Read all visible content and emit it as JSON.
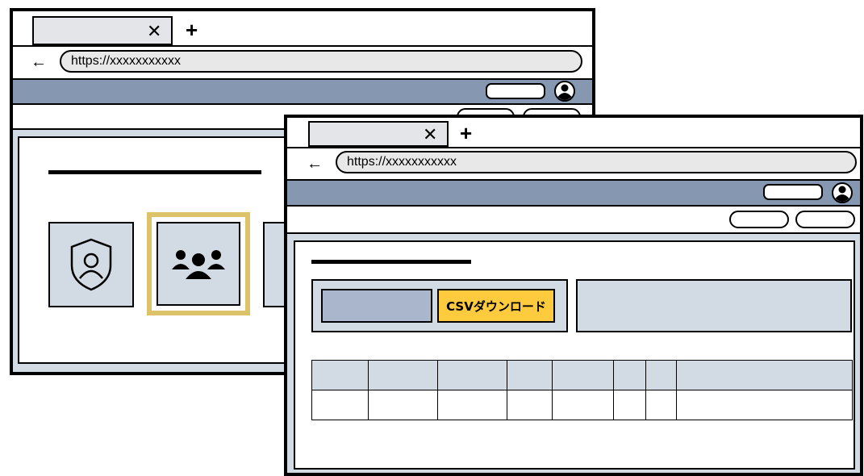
{
  "window_back": {
    "tab": {
      "title": "",
      "close_glyph": "✕"
    },
    "new_tab_glyph": "+",
    "back_glyph": "←",
    "url": "https://xxxxxxxxxxx",
    "icons": [
      "shield-user-icon",
      "users-group-icon"
    ]
  },
  "window_front": {
    "tab": {
      "title": "",
      "close_glyph": "✕"
    },
    "new_tab_glyph": "+",
    "back_glyph": "←",
    "url": "https://xxxxxxxxxxx",
    "csv_button_label": "CSVダウンロード",
    "table": {
      "columns": 8,
      "rows": 1
    }
  },
  "colors": {
    "navbar": "#8597b1",
    "content_bg": "#d2dae4",
    "csv_button": "#fecb3e",
    "selected_frame": "#dcc36a",
    "filter_box": "#a9b6cc"
  }
}
